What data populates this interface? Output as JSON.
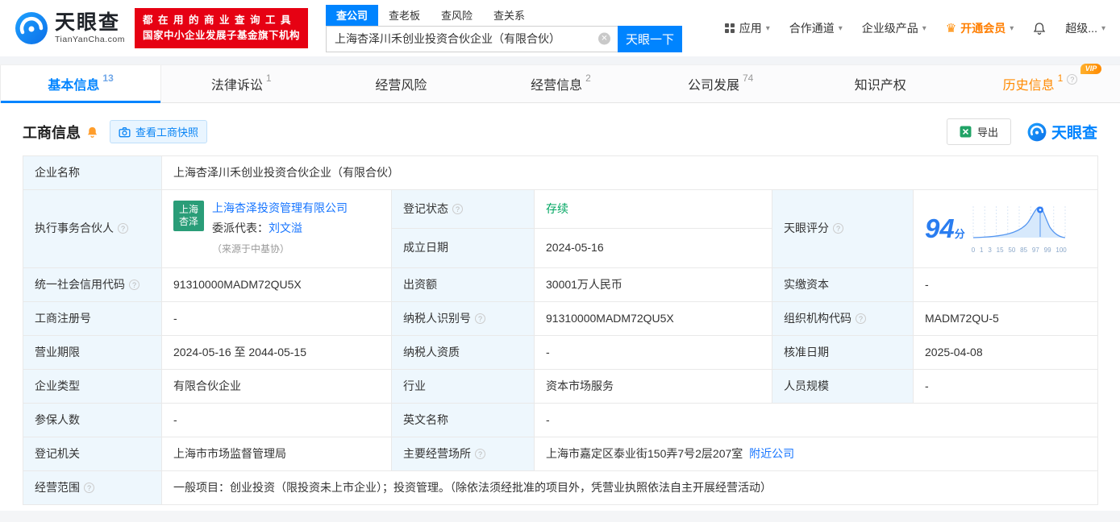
{
  "header": {
    "brand": "天眼查",
    "brand_domain": "TianYanCha.com",
    "slogan_line1": "都在用的商业查询工具",
    "slogan_line2": "国家中小企业发展子基金旗下机构",
    "search_tabs": [
      {
        "label": "查公司"
      },
      {
        "label": "查老板"
      },
      {
        "label": "查风险"
      },
      {
        "label": "查关系"
      }
    ],
    "search_value": "上海杏泽川禾创业投资合伙企业（有限合伙）",
    "search_button": "天眼一下",
    "nav_apps": "应用",
    "nav_cooperation": "合作通道",
    "nav_enterprise": "企业级产品",
    "nav_vip": "开通会员",
    "nav_super": "超级..."
  },
  "tabs": [
    {
      "label": "基本信息",
      "count": "13"
    },
    {
      "label": "法律诉讼",
      "count": "1"
    },
    {
      "label": "经营风险",
      "count": ""
    },
    {
      "label": "经营信息",
      "count": "2"
    },
    {
      "label": "公司发展",
      "count": "74"
    },
    {
      "label": "知识产权",
      "count": ""
    },
    {
      "label": "历史信息",
      "count": "1",
      "badge": "VIP"
    }
  ],
  "section": {
    "title": "工商信息",
    "snapshot_button": "查看工商快照",
    "export_button": "导出",
    "brand": "天眼查"
  },
  "info": {
    "company_name_label": "企业名称",
    "company_name": "上海杏泽川禾创业投资合伙企业（有限合伙）",
    "partner_label": "执行事务合伙人",
    "partner_logo_line1": "上海",
    "partner_logo_line2": "杏泽",
    "partner_company": "上海杏泽投资管理有限公司",
    "rep_label": "委派代表：",
    "rep_name": "刘文溢",
    "rep_source": "（来源于中基协）",
    "reg_status_label": "登记状态",
    "reg_status": "存续",
    "establish_date_label": "成立日期",
    "establish_date": "2024-05-16",
    "score_label": "天眼评分",
    "score_value": "94",
    "score_unit": "分",
    "score_ticks": [
      "0",
      "1",
      "3",
      "15",
      "50",
      "85",
      "97",
      "99",
      "100"
    ],
    "credit_code_label": "统一社会信用代码",
    "credit_code": "91310000MADM72QU5X",
    "capital_label": "出资额",
    "capital": "30001万人民币",
    "paid_capital_label": "实缴资本",
    "paid_capital": "-",
    "reg_no_label": "工商注册号",
    "reg_no": "-",
    "taxpayer_id_label": "纳税人识别号",
    "taxpayer_id": "91310000MADM72QU5X",
    "org_code_label": "组织机构代码",
    "org_code": "MADM72QU-5",
    "term_label": "营业期限",
    "term": "2024-05-16 至 2044-05-15",
    "taxpayer_quality_label": "纳税人资质",
    "taxpayer_quality": "-",
    "approve_date_label": "核准日期",
    "approve_date": "2025-04-08",
    "company_type_label": "企业类型",
    "company_type": "有限合伙企业",
    "industry_label": "行业",
    "industry": "资本市场服务",
    "staff_label": "人员规模",
    "staff": "-",
    "insured_label": "参保人数",
    "insured": "-",
    "en_name_label": "英文名称",
    "en_name": "-",
    "authority_label": "登记机关",
    "authority": "上海市市场监督管理局",
    "address_label": "主要经营场所",
    "address": "上海市嘉定区泰业街150弄7号2层207室",
    "nearby": "附近公司",
    "scope_label": "经营范围",
    "scope": "一般项目：创业投资（限投资未上市企业）；投资管理。（除依法须经批准的项目外，凭营业执照依法自主开展经营活动）"
  }
}
